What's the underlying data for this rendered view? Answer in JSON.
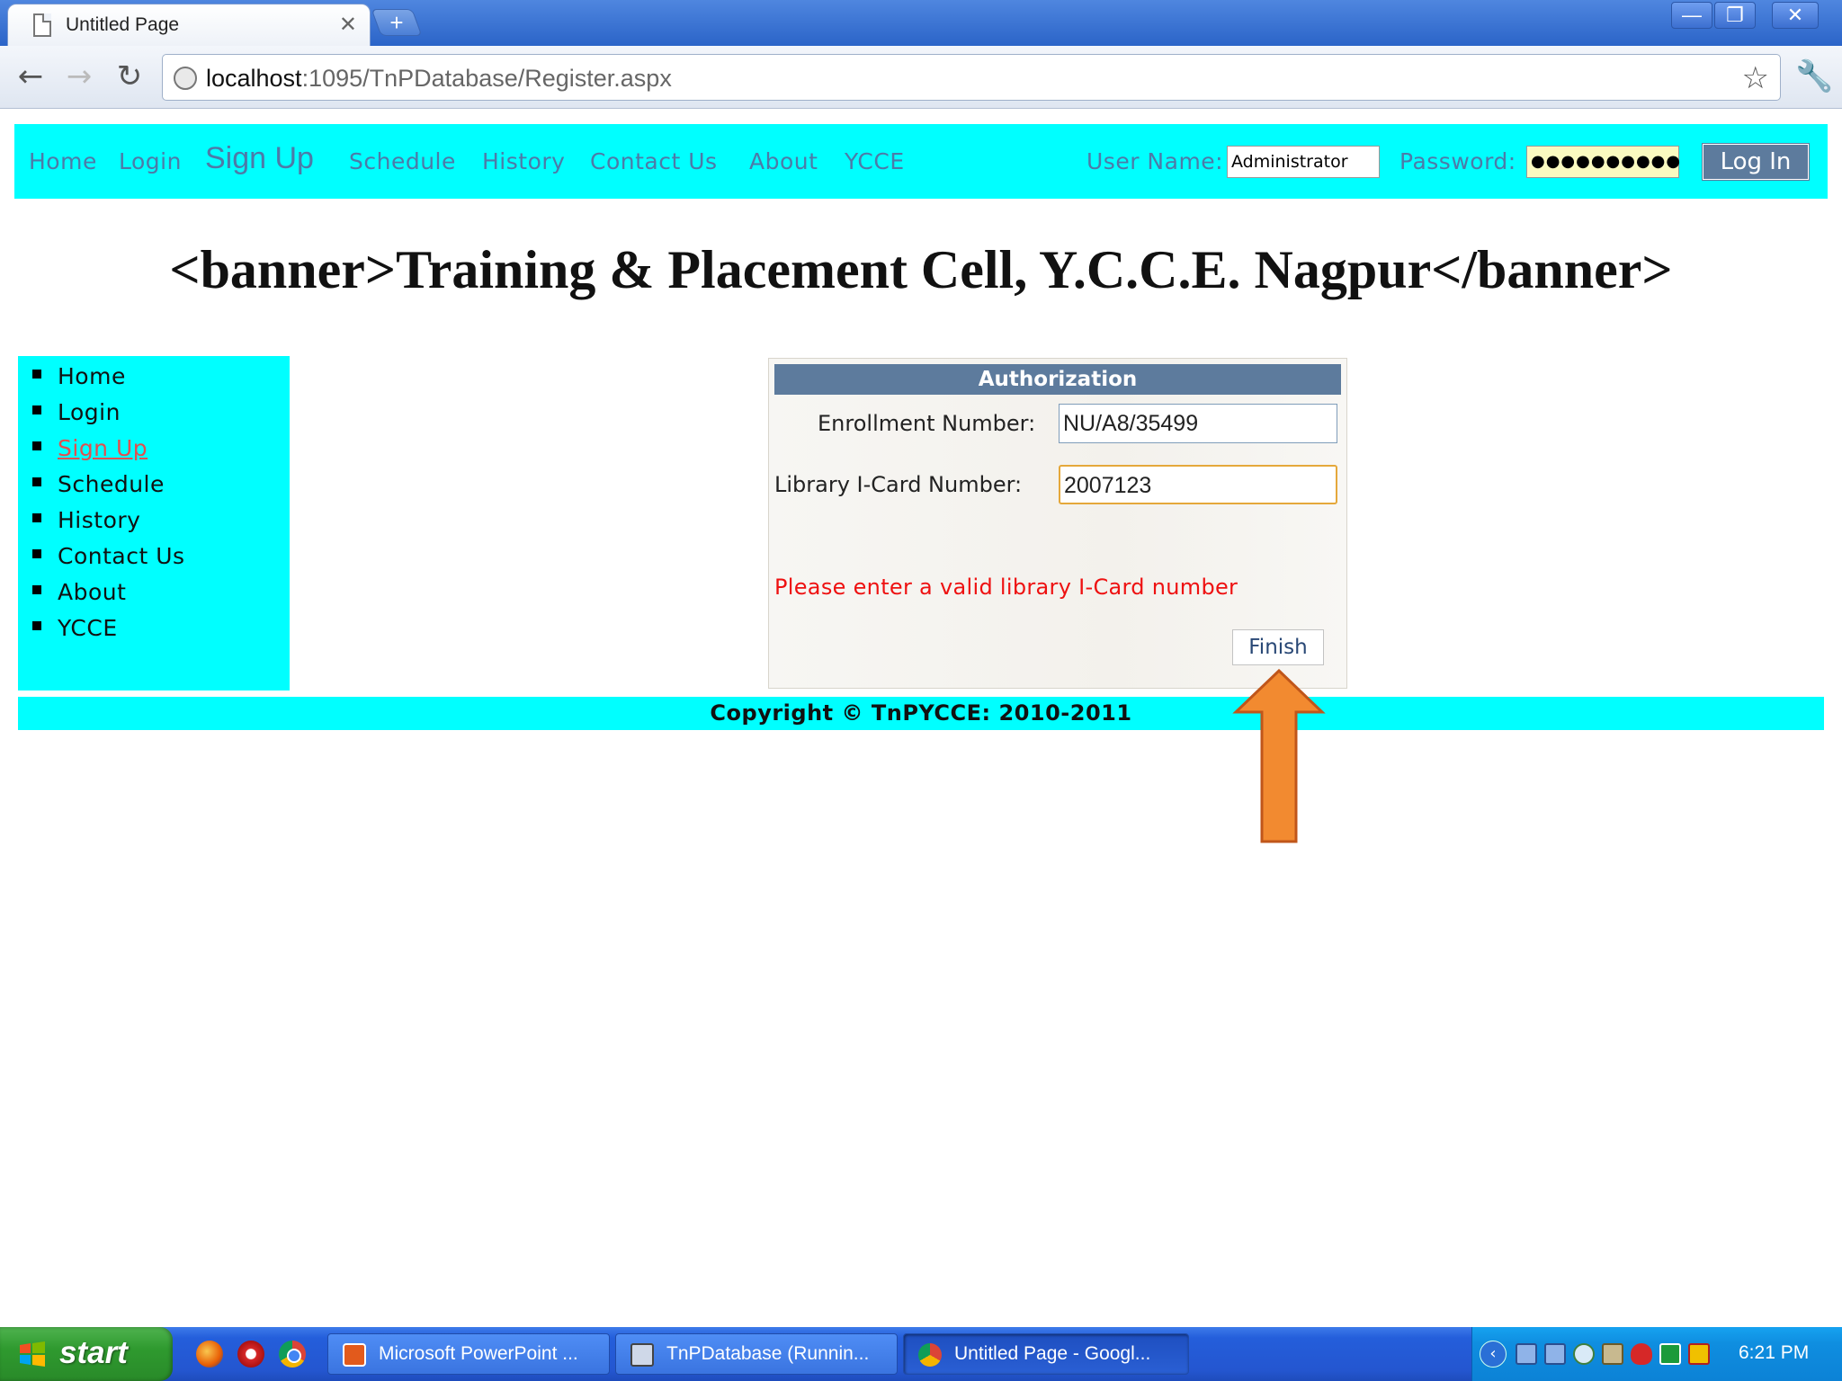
{
  "browser": {
    "tab_title": "Untitled Page",
    "tab_close": "✕",
    "new_tab": "+",
    "url_host": "localhost",
    "url_rest": ":1095/TnPDatabase/Register.aspx",
    "window_buttons": {
      "minimize": "—",
      "maximize": "❐",
      "close": "✕"
    }
  },
  "topnav": {
    "links": [
      "Home",
      "Login",
      "Sign Up",
      "Schedule",
      "History",
      "Contact Us",
      "About",
      "YCCE"
    ],
    "username_label": "User Name:",
    "username_value": "Administrator",
    "password_label": "Password:",
    "password_value": "●●●●●●●●●●",
    "login_button": "Log In"
  },
  "banner": "<banner>Training & Placement Cell, Y.C.C.E. Nagpur</banner>",
  "sidebar": {
    "items": [
      {
        "label": "Home",
        "active": false
      },
      {
        "label": "Login",
        "active": false
      },
      {
        "label": "Sign Up",
        "active": true
      },
      {
        "label": "Schedule",
        "active": false
      },
      {
        "label": "History",
        "active": false
      },
      {
        "label": "Contact Us",
        "active": false
      },
      {
        "label": "About",
        "active": false
      },
      {
        "label": "YCCE",
        "active": false
      }
    ]
  },
  "auth": {
    "title": "Authorization",
    "enrollment_label": "Enrollment Number:",
    "enrollment_value": "NU/A8/35499",
    "library_label": "Library I-Card Number:",
    "library_value": "2007123",
    "error": "Please enter a valid library I-Card number",
    "finish_button": "Finish"
  },
  "footer": "Copyright © TnPYCCE: 2010-2011",
  "colors": {
    "nav_background": "#00ffff",
    "header_blue": "#5d7b9d",
    "error_red": "#ee1111",
    "annotation_arrow": "#f28a30"
  },
  "icons": {
    "back": "back-arrow-icon",
    "forward": "forward-arrow-icon",
    "reload": "reload-icon",
    "bookmark": "star-icon",
    "settings": "wrench-icon"
  },
  "taskbar": {
    "start": "start",
    "tasks": [
      "Microsoft PowerPoint ...",
      "TnPDatabase (Runnin...",
      "Untitled Page - Googl..."
    ],
    "clock": "6:21 PM"
  }
}
